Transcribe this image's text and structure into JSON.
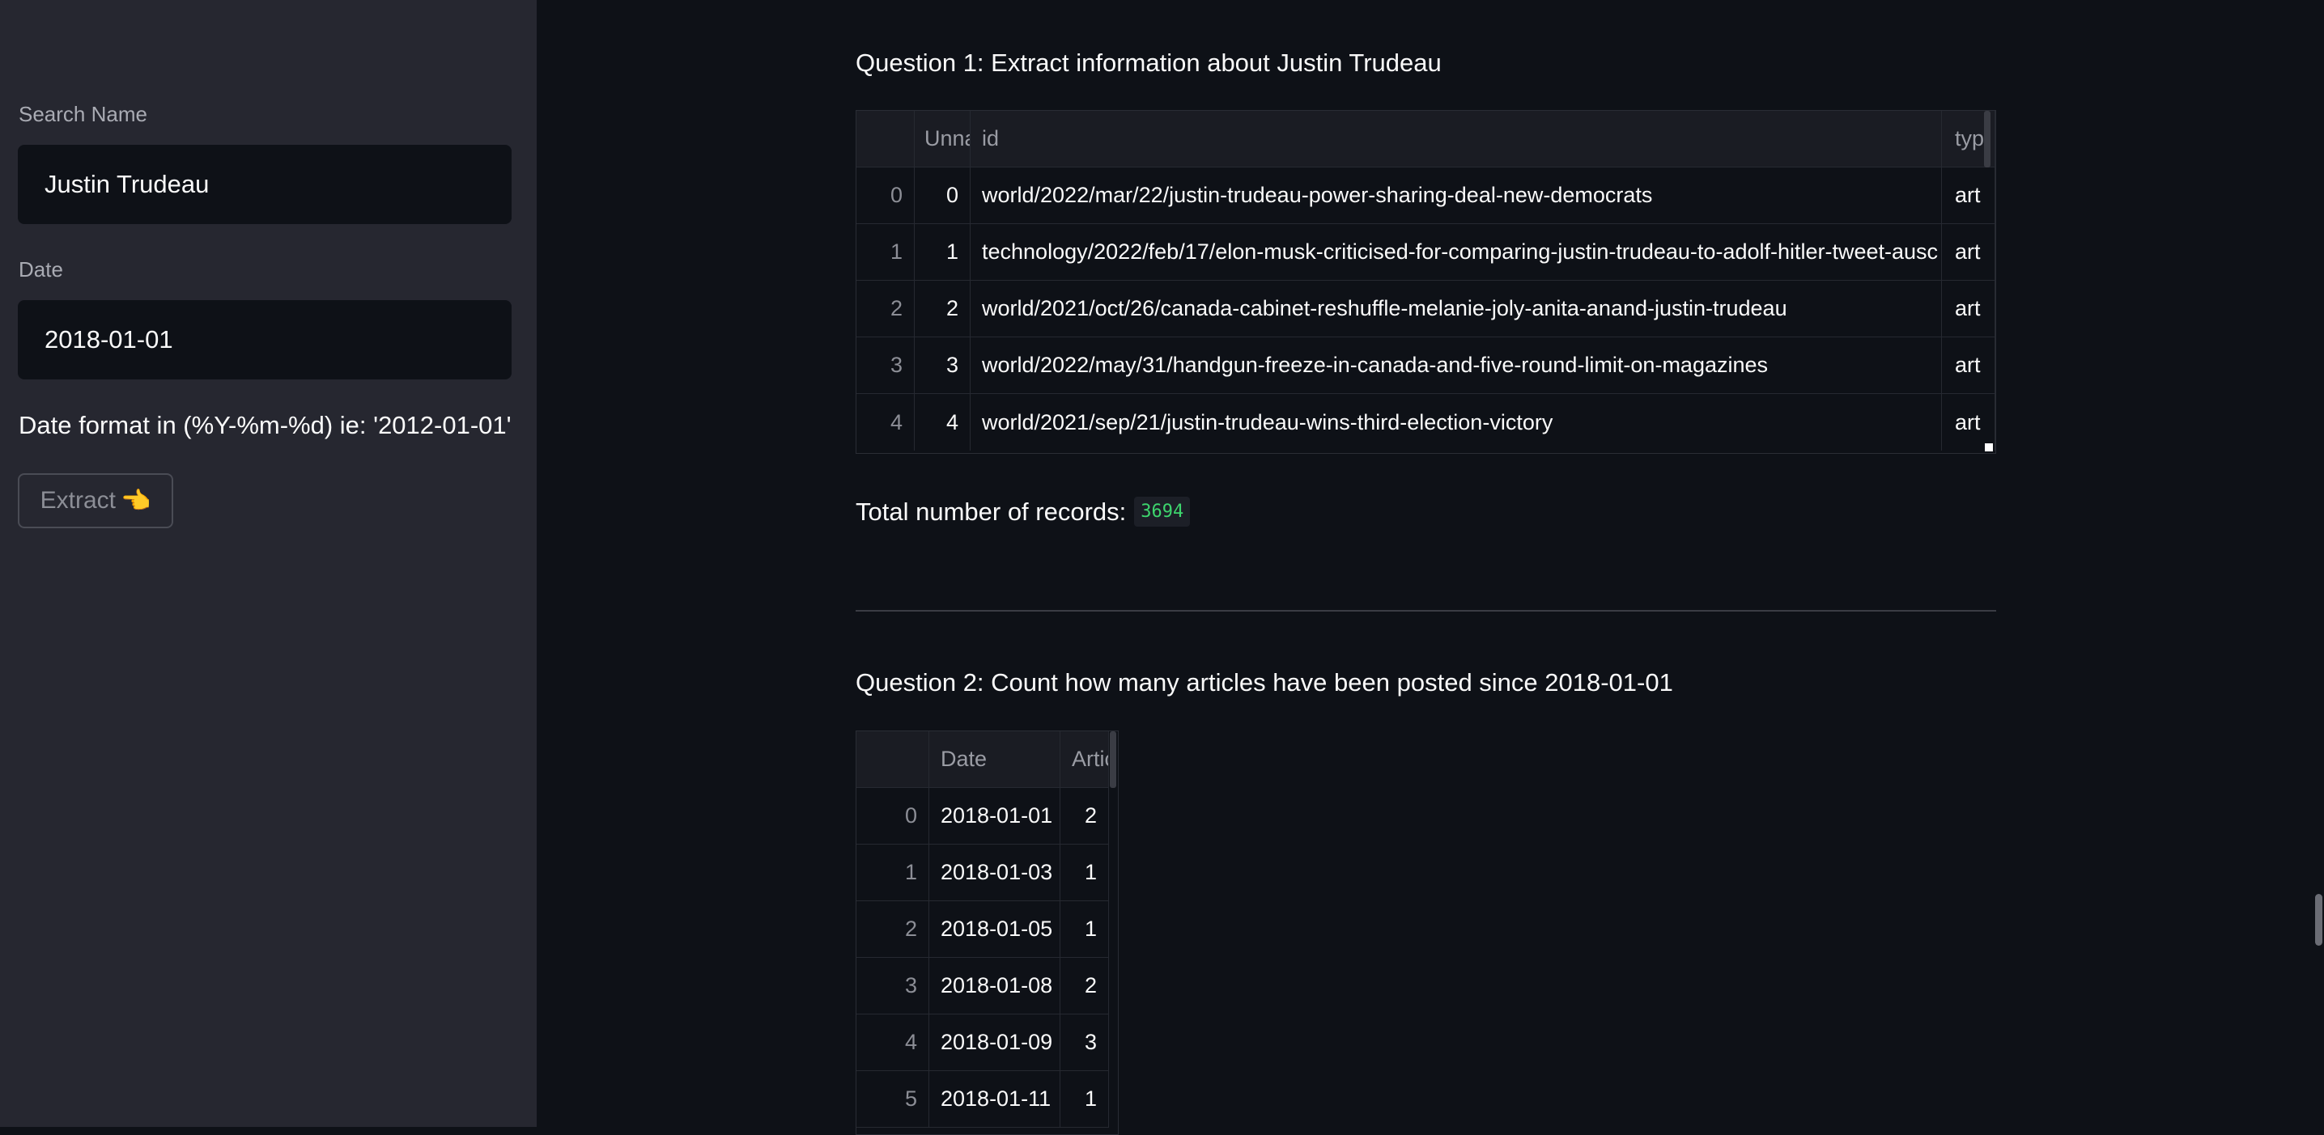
{
  "sidebar": {
    "search_label": "Search Name",
    "search_value": "Justin Trudeau",
    "date_label": "Date",
    "date_value": "2018-01-01",
    "date_note": "Date format in (%Y-%m-%d) ie: '2012-01-01'",
    "extract_label": "Extract",
    "extract_icon": "👈"
  },
  "q1": {
    "heading": "Question 1: Extract information about Justin Trudeau",
    "columns": [
      "",
      "Unna",
      "id",
      "typ"
    ],
    "rows": [
      {
        "index": "0",
        "unnamed": "0",
        "id": "world/2022/mar/22/justin-trudeau-power-sharing-deal-new-democrats",
        "type": "art"
      },
      {
        "index": "1",
        "unnamed": "1",
        "id": "technology/2022/feb/17/elon-musk-criticised-for-comparing-justin-trudeau-to-adolf-hitler-tweet-ausc",
        "type": "art"
      },
      {
        "index": "2",
        "unnamed": "2",
        "id": "world/2021/oct/26/canada-cabinet-reshuffle-melanie-joly-anita-anand-justin-trudeau",
        "type": "art"
      },
      {
        "index": "3",
        "unnamed": "3",
        "id": "world/2022/may/31/handgun-freeze-in-canada-and-five-round-limit-on-magazines",
        "type": "art"
      },
      {
        "index": "4",
        "unnamed": "4",
        "id": "world/2021/sep/21/justin-trudeau-wins-third-election-victory",
        "type": "art"
      }
    ],
    "records_label": "Total number of records:",
    "records_count": "3694"
  },
  "q2": {
    "heading": "Question 2: Count how many articles have been posted since 2018-01-01",
    "columns": [
      "",
      "Date",
      "Artic"
    ],
    "rows": [
      {
        "index": "0",
        "date": "2018-01-01",
        "articles": "2"
      },
      {
        "index": "1",
        "date": "2018-01-03",
        "articles": "1"
      },
      {
        "index": "2",
        "date": "2018-01-05",
        "articles": "1"
      },
      {
        "index": "3",
        "date": "2018-01-08",
        "articles": "2"
      },
      {
        "index": "4",
        "date": "2018-01-09",
        "articles": "3"
      },
      {
        "index": "5",
        "date": "2018-01-11",
        "articles": "1"
      }
    ]
  }
}
